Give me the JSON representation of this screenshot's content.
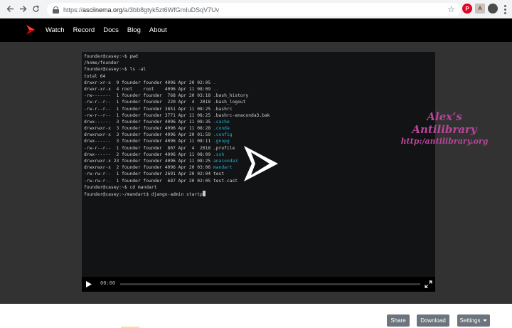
{
  "browser": {
    "url_host": "asciinema.org",
    "url_path": "/a/3bb8gtyk5zt6WfGmIuDSqV7Uv",
    "url_prefix": "https://"
  },
  "site_nav": [
    {
      "label": "Watch"
    },
    {
      "label": "Record"
    },
    {
      "label": "Docs"
    },
    {
      "label": "Blog"
    },
    {
      "label": "About"
    }
  ],
  "terminal": {
    "lines": [
      "founder@casey:~$ pwd",
      "/home/founder",
      "founder@casey:~$ ls -al",
      "total 64",
      "drwxr-xr-x  9 founder founder 4096 Apr 20 02:05 .",
      "drwxr-xr-x  4 root    root    4096 Apr 11 08:09 ..",
      "-rw-------  1 founder founder  768 Apr 20 03:18 .bash_history",
      "-rw-r--r--  1 founder founder  220 Apr  4  2018 .bash_logout",
      "-rw-r--r--  1 founder founder 3851 Apr 11 08:25 .bashrc",
      "-rw-r--r--  1 founder founder 3771 Apr 11 08:25 .bashrc-anaconda3.bak",
      "drwx------  3 founder founder 4096 Apr 11 08:35 .cache",
      "drwxrwxr-x  3 founder founder 4096 Apr 11 08:28 .conda",
      "drwxrwxr-x  3 founder founder 4096 Apr 20 01:59 .config",
      "drwx------  3 founder founder 4096 Apr 11 08:11 .gnupg",
      "-rw-r--r--  1 founder founder  807 Apr  4  2018 .profile",
      "drwx------  2 founder founder 4096 Apr 11 08:09 .ssh",
      "drwxrwxr-x 23 founder founder 4096 Apr 11 08:25 anaconda3",
      "drwxrwxr-x  2 founder founder 4096 Apr 20 03:06 mandart",
      "-rw-rw-r--  1 founder founder 2691 Apr 20 02:04 test",
      "-rw-rw-r--  1 founder founder  687 Apr 20 02:05 test.cast",
      "founder@casey:~$ cd mandart",
      "founder@casey:~/mandart$ django-admin startp"
    ],
    "highlight_color": "#26b0d7"
  },
  "player": {
    "time": "00:00",
    "progress": 0
  },
  "watermark": {
    "line1": "Alex’s Antilibrary",
    "line2": "http:/antilibrary.org"
  },
  "actions": {
    "share": "Share",
    "download": "Download",
    "settings": "Settings"
  },
  "colors": {
    "brand": "#d40000",
    "button": "#6c757d",
    "watermark": "#b8459a"
  }
}
